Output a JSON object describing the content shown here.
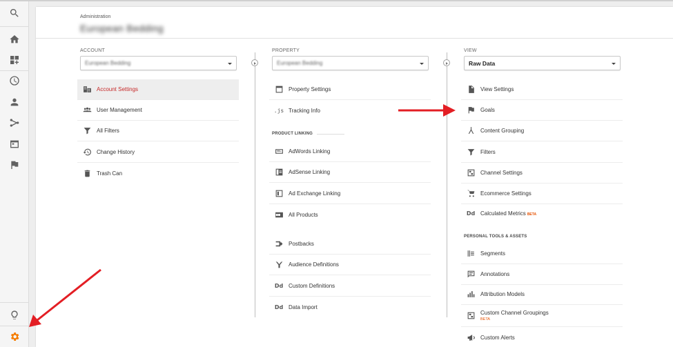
{
  "header": {
    "admin_label": "Administration",
    "account_name": "European Bedding"
  },
  "account": {
    "label": "ACCOUNT",
    "selected": "European Bedding",
    "items": [
      {
        "label": "Account Settings",
        "icon": "building-icon"
      },
      {
        "label": "User Management",
        "icon": "users-icon"
      },
      {
        "label": "All Filters",
        "icon": "filter-icon"
      },
      {
        "label": "Change History",
        "icon": "history-icon"
      },
      {
        "label": "Trash Can",
        "icon": "trash-icon"
      }
    ]
  },
  "property": {
    "label": "PROPERTY",
    "selected": "European Bedding",
    "items": [
      {
        "label": "Property Settings",
        "icon": "window-icon"
      },
      {
        "label": "Tracking Info",
        "icon": "js-icon"
      }
    ],
    "product_linking_title": "PRODUCT LINKING",
    "linking_items": [
      {
        "label": "AdWords Linking",
        "icon": "adwords-icon"
      },
      {
        "label": "AdSense Linking",
        "icon": "adsense-icon"
      },
      {
        "label": "Ad Exchange Linking",
        "icon": "ad-exchange-icon"
      },
      {
        "label": "All Products",
        "icon": "all-products-icon"
      }
    ],
    "other_items": [
      {
        "label": "Postbacks",
        "icon": "postbacks-icon"
      },
      {
        "label": "Audience Definitions",
        "icon": "audience-icon"
      },
      {
        "label": "Custom Definitions",
        "icon": "dd-icon"
      },
      {
        "label": "Data Import",
        "icon": "dd-icon"
      }
    ]
  },
  "view": {
    "label": "VIEW",
    "selected": "Raw Data",
    "items": [
      {
        "label": "View Settings",
        "icon": "document-icon"
      },
      {
        "label": "Goals",
        "icon": "flag-icon"
      },
      {
        "label": "Content Grouping",
        "icon": "grouping-icon"
      },
      {
        "label": "Filters",
        "icon": "filter-icon"
      },
      {
        "label": "Channel Settings",
        "icon": "channel-icon"
      },
      {
        "label": "Ecommerce Settings",
        "icon": "cart-icon"
      },
      {
        "label": "Calculated Metrics",
        "icon": "dd-icon",
        "badge": "BETA"
      }
    ],
    "personal_title": "PERSONAL TOOLS & ASSETS",
    "personal_items": [
      {
        "label": "Segments",
        "icon": "segments-icon"
      },
      {
        "label": "Annotations",
        "icon": "annotations-icon"
      },
      {
        "label": "Attribution Models",
        "icon": "attribution-icon"
      },
      {
        "label": "Custom Channel Groupings",
        "icon": "channel-icon",
        "badge": "BETA"
      },
      {
        "label": "Custom Alerts",
        "icon": "megaphone-icon"
      }
    ]
  },
  "colors": {
    "accent_red": "#c62828",
    "beta_orange": "#e65100",
    "gear_orange": "#f57c00",
    "arrow_red": "#e31e24"
  }
}
